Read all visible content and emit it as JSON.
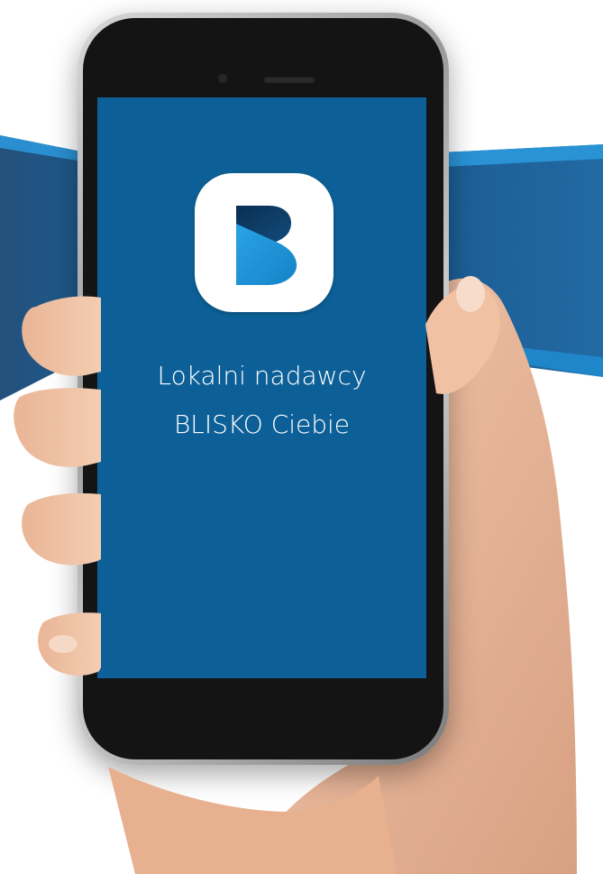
{
  "app": {
    "tagline_line1": "Lokalni nadawcy",
    "tagline_line2": "BLISKO Ciebie",
    "logo_icon": "b-letter-logo-icon"
  },
  "colors": {
    "screen_bg": "#0d6097",
    "logo_bg": "#ffffff",
    "logo_dark": "#0b3a61",
    "logo_light": "#2a9ee0"
  }
}
